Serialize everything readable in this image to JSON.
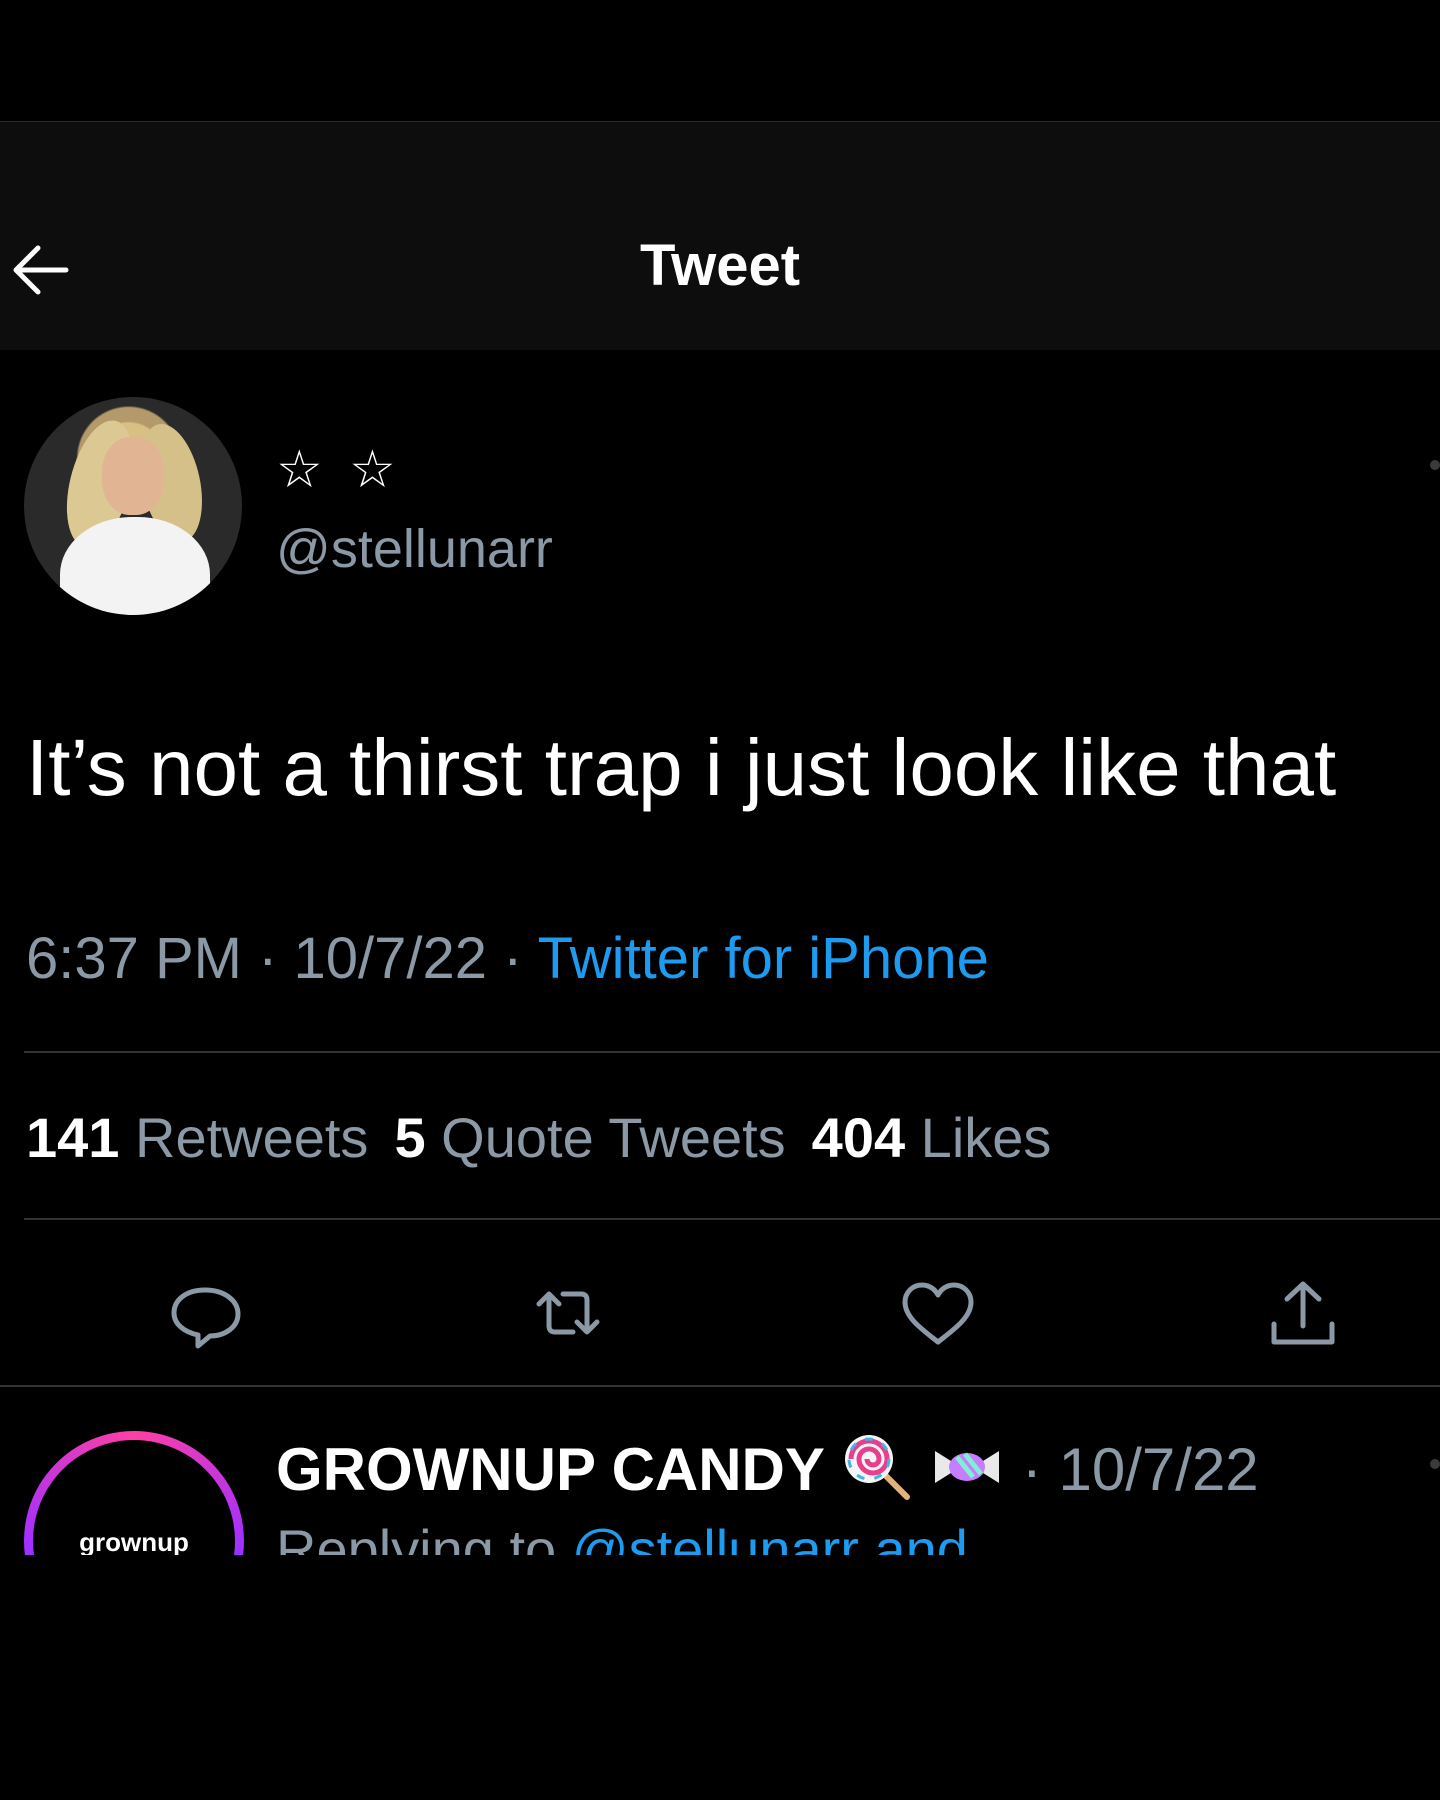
{
  "header": {
    "title": "Tweet"
  },
  "tweet": {
    "display_name": "☆ ☆",
    "handle": "@stellunarr",
    "text": "It’s not a thirst trap i just look like that",
    "time": "6:37 PM",
    "date": "10/7/22",
    "separator": " · ",
    "source": "Twitter for iPhone"
  },
  "stats": {
    "retweets_count": "141",
    "retweets_label": "Retweets",
    "quotes_count": "5",
    "quotes_label": "Quote Tweets",
    "likes_count": "404",
    "likes_label": "Likes"
  },
  "reply": {
    "display_name": "GROWNUP CANDY",
    "avatar_text": "grownup",
    "date": "· 10/7/22",
    "replying_prefix": "Replying to ",
    "replying_mention": "@stellunarr and"
  },
  "colors": {
    "accent": "#1d9bf0",
    "muted": "#8b98a5",
    "background": "#000000"
  },
  "icons": [
    "back-arrow-icon",
    "reply-icon",
    "retweet-icon",
    "heart-icon",
    "share-icon",
    "lollipop-icon",
    "candy-icon"
  ]
}
